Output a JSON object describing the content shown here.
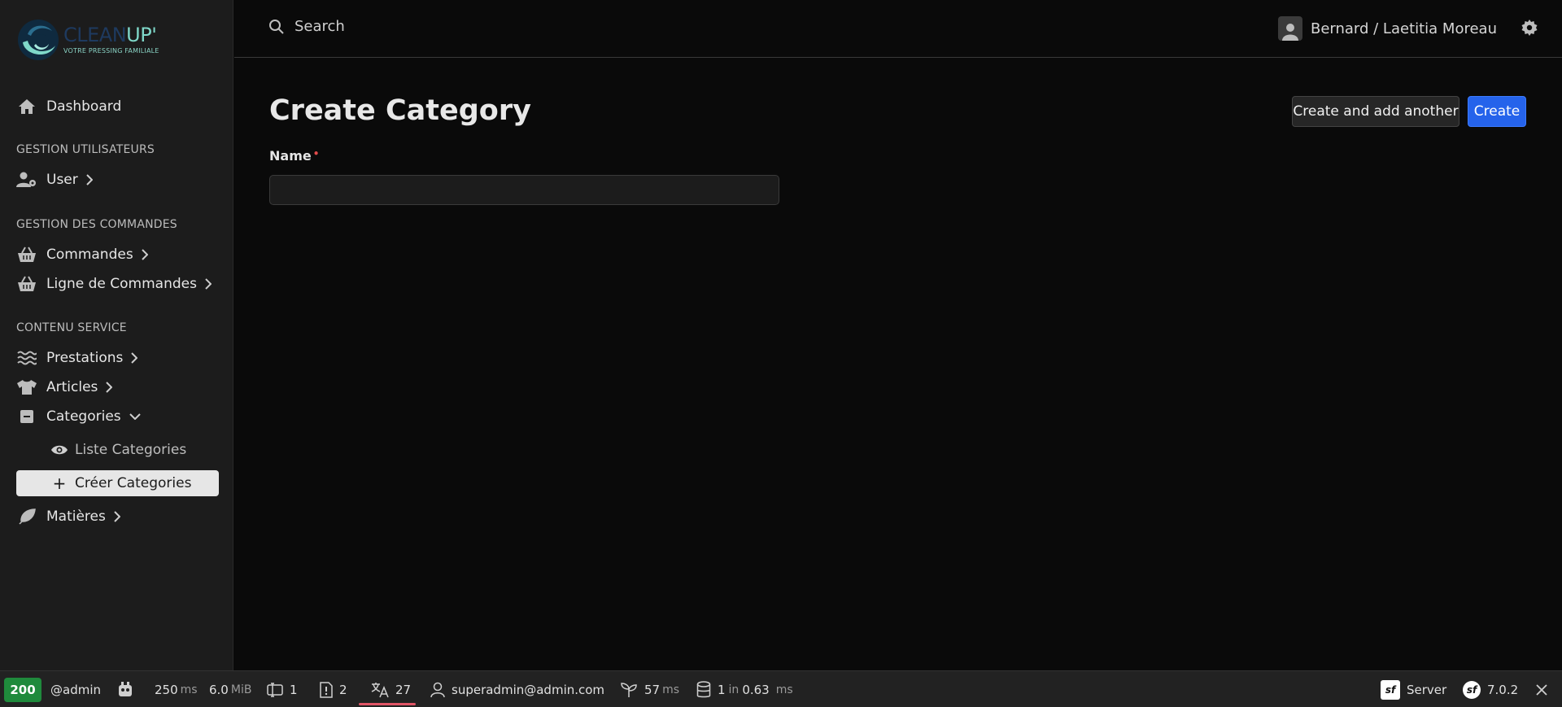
{
  "brand": {
    "name_part1": "CLEAN",
    "name_part2": "UP'",
    "tagline": "VOTRE PRESSING FAMILIALE"
  },
  "sidebar": {
    "dashboard": "Dashboard",
    "sections": [
      {
        "title": "GESTION UTILISATEURS"
      },
      {
        "title": "GESTION DES COMMANDES"
      },
      {
        "title": "CONTENU SERVICE"
      }
    ],
    "items": {
      "user": "User",
      "commandes": "Commandes",
      "ligne_commandes": "Ligne de Commandes",
      "prestations": "Prestations",
      "articles": "Articles",
      "categories": "Categories",
      "liste_categories": "Liste Categories",
      "creer_categories": "Créer Categories",
      "matieres": "Matières"
    }
  },
  "topbar": {
    "search_label": "Search",
    "user_name": "Bernard / Laetitia Moreau"
  },
  "main": {
    "title": "Create Category",
    "btn_create_another": "Create and add another",
    "btn_create": "Create",
    "field_name_label": "Name",
    "field_name_required": "•",
    "field_name_value": ""
  },
  "debug": {
    "status": "200",
    "route": "@admin",
    "time_value": "250",
    "time_unit": "ms",
    "memory_value": "6.0",
    "memory_unit": "MiB",
    "forms": "1",
    "logs": "2",
    "translations": "27",
    "user": "superadmin@admin.com",
    "init_value": "57",
    "init_unit": "ms",
    "db_count": "1",
    "db_in": "in",
    "db_time": "0.63",
    "db_unit": "ms",
    "server": "Server",
    "version": "7.0.2"
  },
  "colors": {
    "accent": "#2563eb",
    "status_ok": "#1f8a3c",
    "required": "#e24b4b"
  }
}
